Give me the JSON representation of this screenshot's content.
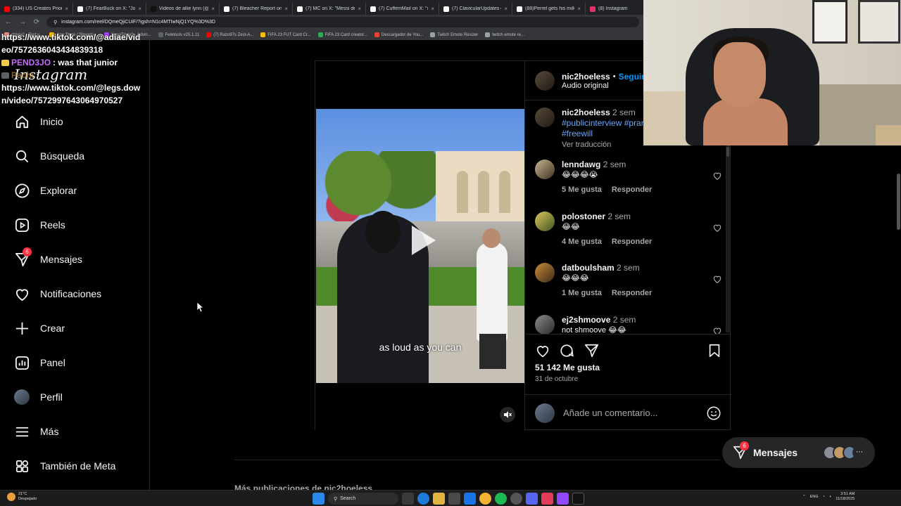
{
  "browser": {
    "tabs": [
      {
        "title": "(334) US Creates Priority",
        "color": "#ff0000"
      },
      {
        "title": "(7) FearBuck on X: \"John",
        "color": "#ffffff"
      },
      {
        "title": "Videos de allie lynn (@all",
        "color": "#111111"
      },
      {
        "title": "(7) Bleacher Report on X",
        "color": "#ffffff"
      },
      {
        "title": "(7) MC on X: \"Messi dead",
        "color": "#ffffff"
      },
      {
        "title": "(7) CuffemMail on X: \"@",
        "color": "#ffffff"
      },
      {
        "title": "(7) ClavicularUpdates on",
        "color": "#ffffff"
      },
      {
        "title": "(88)Perrel gets his milk",
        "color": "#ffffff"
      },
      {
        "title": "(8) Instagram",
        "color": "#e1306c"
      }
    ],
    "url": "instagram.com/reel/DQmeQjiCUiF/?igsh=N1c4MTIwNjQ1YQ%3D%3D",
    "bookmarks": [
      {
        "label": "ctrivia2 - Test y...",
        "color": "#f28b82"
      },
      {
        "label": "App Store / Streami...",
        "color": "#fbbc04"
      },
      {
        "label": "SongTrivia2 - Advin...",
        "color": "#a142f4"
      },
      {
        "label": "Feletools v25.1.11",
        "color": "#5f6368"
      },
      {
        "label": "(7) Razo97s Zest-A...",
        "color": "#ff0000"
      },
      {
        "label": "FIFA 23 FUT Card Cr...",
        "color": "#fbbc04"
      },
      {
        "label": "FIFA 23 Card creator...",
        "color": "#34a853"
      },
      {
        "label": "Descargador de You...",
        "color": "#ea4335"
      },
      {
        "label": "Twitch Emote Resizer",
        "color": "#9aa0a6"
      },
      {
        "label": "twitch emote re...",
        "color": "#9aa0a6"
      }
    ]
  },
  "chat": {
    "line1": "https://www.tiktok.com/@adiae/vid",
    "line2": "eo/7572636043434839318",
    "user1": "PEND3JO",
    "msg1": " : was that junior",
    "user2": "Pachi",
    "msg2": " :",
    "line3": "https://www.tiktok.com/@legs.dow",
    "line4": "n/video/7572997643064970527"
  },
  "logo": "Instagram",
  "sidebar": {
    "items": [
      {
        "label": "Inicio",
        "icon": "home-icon"
      },
      {
        "label": "Búsqueda",
        "icon": "search-icon"
      },
      {
        "label": "Explorar",
        "icon": "compass-icon"
      },
      {
        "label": "Reels",
        "icon": "reels-icon"
      },
      {
        "label": "Mensajes",
        "icon": "messenger-icon",
        "badge": "6"
      },
      {
        "label": "Notificaciones",
        "icon": "heart-icon"
      },
      {
        "label": "Crear",
        "icon": "plus-icon"
      },
      {
        "label": "Panel",
        "icon": "chart-icon"
      },
      {
        "label": "Perfil",
        "icon": "avatar"
      },
      {
        "label": "Más",
        "icon": "menu-icon"
      },
      {
        "label": "También de Meta",
        "icon": "meta-grid-icon"
      }
    ]
  },
  "post": {
    "author": "nic2hoeless",
    "follow": "Seguir",
    "separator": "•",
    "audio": "Audio original",
    "caption_overlay": "as loud as you can",
    "caption": {
      "user": "nic2hoeless",
      "time": "2 sem",
      "tags": "#publicinterview #prar",
      "tags2": "#freewill",
      "translate": "Ver traducción"
    },
    "comments": [
      {
        "user": "lenndawg",
        "time": "2 sem",
        "text": "😂😂😂😭",
        "likes": "5 Me gusta",
        "reply": "Responder"
      },
      {
        "user": "polostoner",
        "time": "2 sem",
        "text": "😂😂",
        "likes": "4 Me gusta",
        "reply": "Responder"
      },
      {
        "user": "datboulsham",
        "time": "2 sem",
        "text": "😂😂😂",
        "likes": "1 Me gusta",
        "reply": "Responder"
      },
      {
        "user": "ej2shmoove",
        "time": "2 sem",
        "text": "not shmoove 😂😂",
        "likes": "",
        "reply": ""
      }
    ],
    "likes": "51 142 Me gusta",
    "date": "31 de octubre",
    "comment_placeholder": "Añade un comentario..."
  },
  "more_from": "Más publicaciones de nic2hoeless",
  "messages_pill": {
    "label": "Mensajes",
    "badge": "6"
  },
  "taskbar": {
    "weather_temp": "21°C",
    "weather_desc": "Despejado",
    "search": "Search",
    "lang": "ENG",
    "time": "3:51 AM",
    "date": "11/18/2025"
  }
}
